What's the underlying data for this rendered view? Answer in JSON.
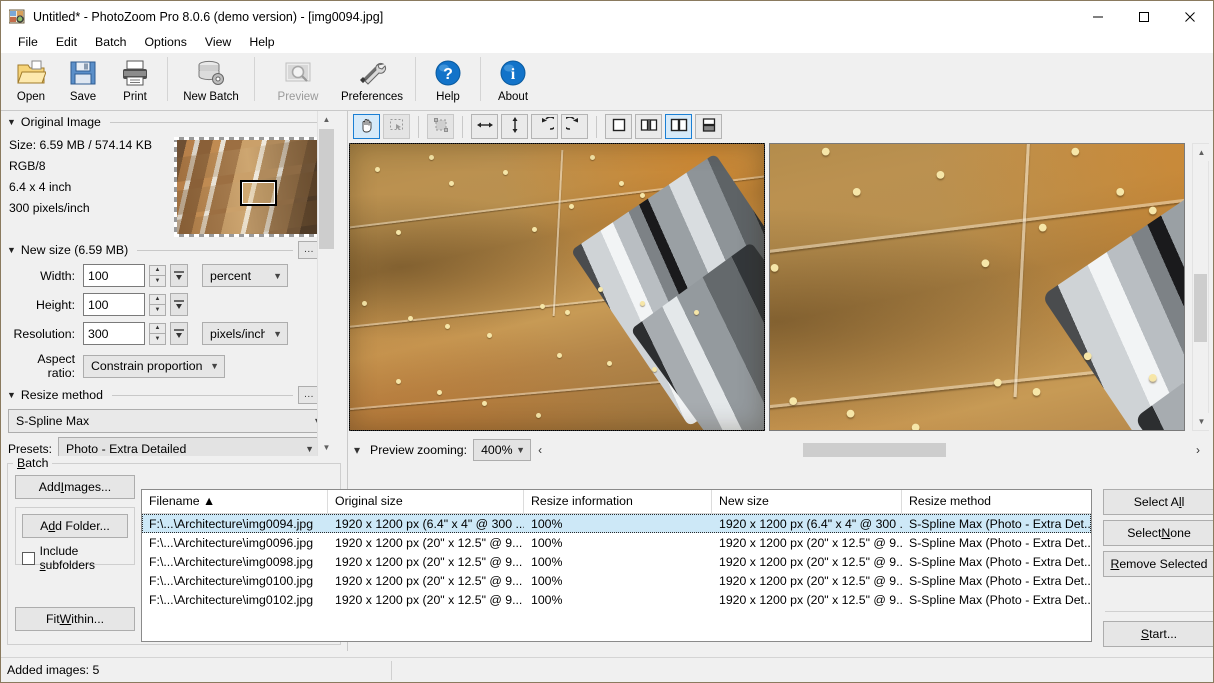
{
  "window": {
    "title": "Untitled* - PhotoZoom Pro 8.0.6 (demo version) - [img0094.jpg]",
    "minimize_label": "—",
    "maximize_label": "☐",
    "close_label": "✕"
  },
  "menubar": {
    "items": [
      {
        "label": "File"
      },
      {
        "label": "Edit"
      },
      {
        "label": "Batch"
      },
      {
        "label": "Options"
      },
      {
        "label": "View"
      },
      {
        "label": "Help"
      }
    ]
  },
  "toolbar": {
    "buttons": [
      {
        "label": "Open",
        "icon": "open-folder-icon",
        "disabled": false
      },
      {
        "label": "Save",
        "icon": "floppy-disk-icon",
        "disabled": false
      },
      {
        "label": "Print",
        "icon": "printer-icon",
        "disabled": false
      },
      {
        "label": "New Batch",
        "icon": "database-stack-icon",
        "disabled": false
      },
      {
        "label": "Preview",
        "icon": "preview-magnifier-icon",
        "disabled": true
      },
      {
        "label": "Preferences",
        "icon": "tools-wrench-screwdriver-icon",
        "disabled": false
      },
      {
        "label": "Help",
        "icon": "question-mark-icon",
        "disabled": false
      },
      {
        "label": "About",
        "icon": "info-icon",
        "disabled": false
      }
    ]
  },
  "sidebar": {
    "original_image": {
      "section_title": "Original Image",
      "size": "Size: 6.59 MB / 574.14 KB",
      "color_mode": "RGB/8",
      "dimensions": "6.4 x 4 inch",
      "resolution": "300 pixels/inch"
    },
    "new_size": {
      "section_title": "New size (6.59 MB)",
      "options_button": "...",
      "width_label": "Width:",
      "width_value": "100",
      "height_label": "Height:",
      "height_value": "100",
      "resolution_label": "Resolution:",
      "resolution_value": "300",
      "size_unit": "percent",
      "resolution_unit": "pixels/inch",
      "aspect_label": "Aspect ratio:",
      "aspect_value": "Constrain proportions"
    },
    "resize_method": {
      "section_title": "Resize method",
      "options_button": "...",
      "method_value": "S-Spline Max",
      "presets_label": "Presets:",
      "presets_value": "Photo - Extra Detailed"
    },
    "batch": {
      "legend": "Batch",
      "add_images": "Add Images...",
      "add_folder": "Add Folder...",
      "include_subfolders": "Include subfolders",
      "fit_within": "Fit Within..."
    }
  },
  "preview": {
    "tools": [
      {
        "name": "hand-tool-icon",
        "active": true,
        "disabled": false
      },
      {
        "name": "marquee-select-icon",
        "active": false,
        "disabled": true
      },
      {
        "name": "crop-tool-icon",
        "active": false,
        "disabled": true
      },
      {
        "name": "flip-horizontal-icon",
        "active": false,
        "disabled": false
      },
      {
        "name": "flip-vertical-icon",
        "active": false,
        "disabled": false
      },
      {
        "name": "rotate-left-icon",
        "active": false,
        "disabled": false
      },
      {
        "name": "rotate-right-icon",
        "active": false,
        "disabled": false
      },
      {
        "name": "view-single-icon",
        "active": false,
        "disabled": false
      },
      {
        "name": "view-split-icon",
        "active": false,
        "disabled": false
      },
      {
        "name": "view-side-by-side-icon",
        "active": true,
        "disabled": false
      },
      {
        "name": "view-stacked-icon",
        "active": false,
        "disabled": false
      }
    ],
    "zoom_label": "Preview zooming:",
    "zoom_value": "400%",
    "prev_arrow": "‹",
    "next_arrow": "›"
  },
  "batch_table": {
    "columns": [
      {
        "label": "Filename ▲"
      },
      {
        "label": "Original size"
      },
      {
        "label": "Resize information"
      },
      {
        "label": "New size"
      },
      {
        "label": "Resize method"
      }
    ],
    "rows": [
      {
        "selected": true,
        "filename": "F:\\...\\Architecture\\img0094.jpg",
        "original_size": "1920 x 1200 px (6.4\" x 4\" @ 300 ...",
        "resize_information": "100%",
        "new_size": "1920 x 1200 px (6.4\" x 4\" @ 300 ...",
        "resize_method": "S-Spline Max (Photo - Extra Det..."
      },
      {
        "selected": false,
        "filename": "F:\\...\\Architecture\\img0096.jpg",
        "original_size": "1920 x 1200 px (20\" x 12.5\" @ 9...",
        "resize_information": "100%",
        "new_size": "1920 x 1200 px (20\" x 12.5\" @ 9...",
        "resize_method": "S-Spline Max (Photo - Extra Det..."
      },
      {
        "selected": false,
        "filename": "F:\\...\\Architecture\\img0098.jpg",
        "original_size": "1920 x 1200 px (20\" x 12.5\" @ 9...",
        "resize_information": "100%",
        "new_size": "1920 x 1200 px (20\" x 12.5\" @ 9...",
        "resize_method": "S-Spline Max (Photo - Extra Det..."
      },
      {
        "selected": false,
        "filename": "F:\\...\\Architecture\\img0100.jpg",
        "original_size": "1920 x 1200 px (20\" x 12.5\" @ 9...",
        "resize_information": "100%",
        "new_size": "1920 x 1200 px (20\" x 12.5\" @ 9...",
        "resize_method": "S-Spline Max (Photo - Extra Det..."
      },
      {
        "selected": false,
        "filename": "F:\\...\\Architecture\\img0102.jpg",
        "original_size": "1920 x 1200 px (20\" x 12.5\" @ 9...",
        "resize_information": "100%",
        "new_size": "1920 x 1200 px (20\" x 12.5\" @ 9...",
        "resize_method": "S-Spline Max (Photo - Extra Det..."
      }
    ],
    "side_buttons": {
      "select_all": "Select All",
      "select_none": "Select None",
      "remove_selected": "Remove Selected",
      "start": "Start..."
    }
  },
  "statusbar": {
    "text": "Added images: 5"
  },
  "colors": {
    "accent_selection": "#cde8f7",
    "accent_active_tool": "#1a7fd4",
    "window_bg": "#f0f0f0",
    "titlebar_bg": "#ffffff",
    "border": "#8a7a5e"
  }
}
